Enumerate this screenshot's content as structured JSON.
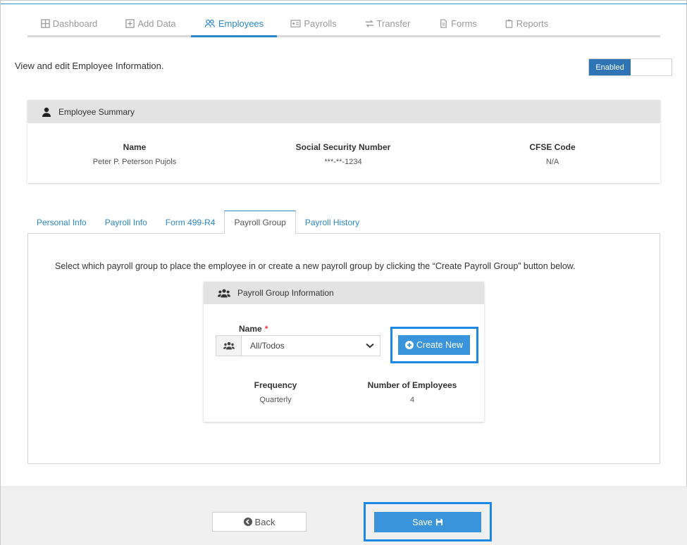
{
  "nav": {
    "items": [
      {
        "label": "Dashboard",
        "icon": "grid-icon"
      },
      {
        "label": "Add Data",
        "icon": "plus-square-icon"
      },
      {
        "label": "Employees",
        "icon": "users-icon"
      },
      {
        "label": "Payrolls",
        "icon": "id-card-icon"
      },
      {
        "label": "Transfer",
        "icon": "transfer-arrows-icon"
      },
      {
        "label": "Forms",
        "icon": "document-icon"
      },
      {
        "label": "Reports",
        "icon": "clipboard-icon"
      }
    ],
    "active": "Employees"
  },
  "intro": "View and edit Employee Information.",
  "toggle": {
    "label": "Enabled"
  },
  "summary": {
    "title": "Employee Summary",
    "name_label": "Name",
    "name_value": "Peter P. Peterson Pujols",
    "ssn_label": "Social Security Number",
    "ssn_value": "***-**-1234",
    "cfse_label": "CFSE Code",
    "cfse_value": "N/A"
  },
  "tabs": [
    {
      "label": "Personal Info"
    },
    {
      "label": "Payroll Info"
    },
    {
      "label": "Form 499-R4"
    },
    {
      "label": "Payroll Group"
    },
    {
      "label": "Payroll History"
    }
  ],
  "active_tab": "Payroll Group",
  "instruction": "Select which payroll group to place the employee in or create a new payroll group by clicking the “Create Payroll Group” button below.",
  "group": {
    "title": "Payroll Group Information",
    "name_label": "Name",
    "required_mark": "*",
    "selected": "All/Todos",
    "create_label": "Create New",
    "frequency_label": "Frequency",
    "frequency_value": "Quarterly",
    "employees_label": "Number of Employees",
    "employees_value": "4"
  },
  "footer": {
    "back_label": "Back",
    "save_label": "Save"
  },
  "colors": {
    "accent": "#2b87c9",
    "button": "#3a94dc",
    "highlight": "#1e88e5",
    "toggle_on": "#2f75b5"
  }
}
